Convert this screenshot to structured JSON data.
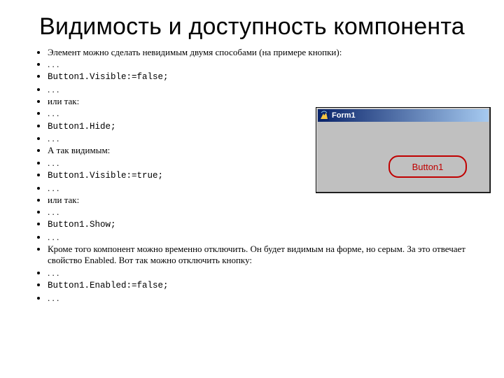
{
  "title": "Видимость и доступность компонента",
  "bullets": [
    {
      "text": "Элемент можно сделать невидимым двумя способами (на примере кнопки):",
      "mono": false
    },
    {
      "text": ". . .",
      "mono": false
    },
    {
      "text": "Button1.Visible:=false;",
      "mono": true
    },
    {
      "text": ". . .",
      "mono": false
    },
    {
      "text": "или так:",
      "mono": false
    },
    {
      "text": ". . .",
      "mono": false
    },
    {
      "text": "Button1.Hide;",
      "mono": true
    },
    {
      "text": ". . .",
      "mono": false
    },
    {
      "text": "А так видимым:",
      "mono": false
    },
    {
      "text": ". . .",
      "mono": false
    },
    {
      "text": "Button1.Visible:=true;",
      "mono": true
    },
    {
      "text": ". . .",
      "mono": false
    },
    {
      "text": "или так:",
      "mono": false
    },
    {
      "text": ". . .",
      "mono": false
    },
    {
      "text": "Button1.Show;",
      "mono": true
    },
    {
      "text": ". . .",
      "mono": false
    },
    {
      "text": "Кроме того компонент можно временно отключить. Он будет видимым на форме, но серым. За это отвечает свойство Enabled. Вот так можно отключить кнопку:",
      "mono": false
    },
    {
      "text": ". . .",
      "mono": false
    },
    {
      "text": "Button1.Enabled:=false;",
      "mono": true
    },
    {
      "text": ". . .",
      "mono": false
    }
  ],
  "window": {
    "title": "Form1",
    "button_label": "Button1"
  }
}
